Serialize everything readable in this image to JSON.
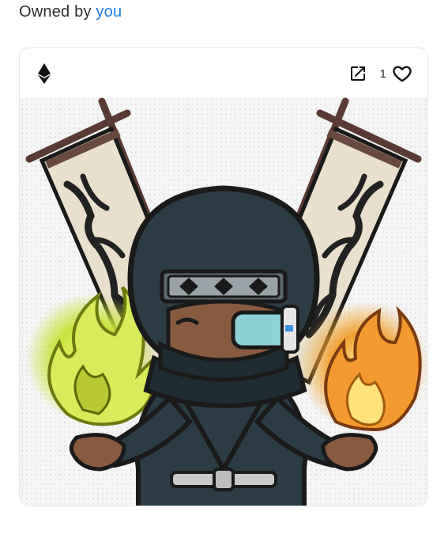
{
  "ownership": {
    "prefix": "Owned by",
    "owner_name": "you"
  },
  "card": {
    "chain_icon": "ethereum-icon",
    "external_link_icon": "external-link-icon",
    "favorite_count": "1",
    "favorite_icon": "heart-outline-icon"
  },
  "artwork": {
    "subject": "ninja-character-illustration",
    "colors": {
      "outfit": "#2c3d45",
      "outline": "#1a1a1a",
      "skin": "#8a5a3e",
      "green_flame": "#c7e23a",
      "orange_flame": "#f0a030",
      "banner": "#e8e0cc"
    }
  }
}
